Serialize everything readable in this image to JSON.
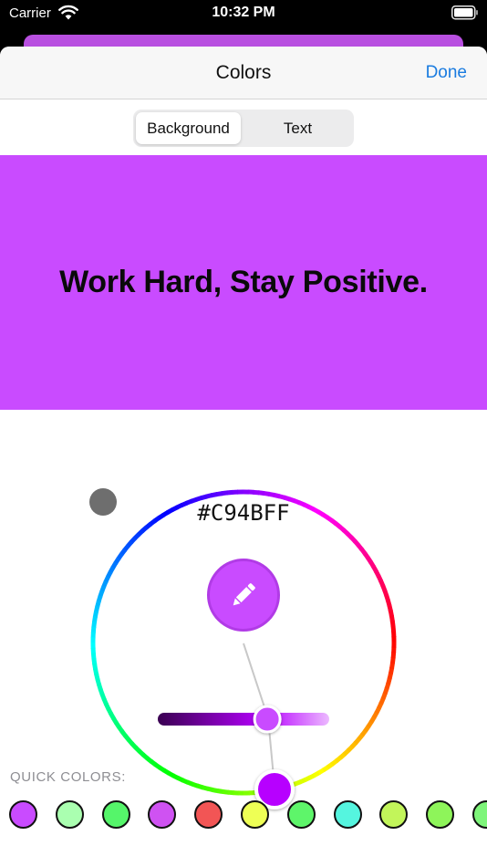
{
  "status_bar": {
    "carrier": "Carrier",
    "time": "10:32 PM"
  },
  "nav": {
    "title": "Colors",
    "done_label": "Done"
  },
  "segments": {
    "background_label": "Background",
    "text_label": "Text",
    "selected": "Background"
  },
  "preview": {
    "text": "Work Hard, Stay Positive.",
    "background_color": "#C94BFF",
    "text_color": "#0A0A0A"
  },
  "picker": {
    "hex_value": "#C94BFF",
    "brightness_fraction": 0.65,
    "hue_handle_color": "#B700FF",
    "history_dot_color": "#6E6E6E"
  },
  "quick_colors": {
    "label": "QUICK COLORS:",
    "swatches": [
      "#C94BFF",
      "#AAFFB0",
      "#55F56A",
      "#CF52F2",
      "#F25555",
      "#EEFF55",
      "#5EF56A",
      "#55F5DF",
      "#C2F55A",
      "#8EF55A",
      "#7EF57A"
    ]
  },
  "colors": {
    "accent": "#1B7CE0",
    "sheet_behind": "#B84FE0"
  }
}
